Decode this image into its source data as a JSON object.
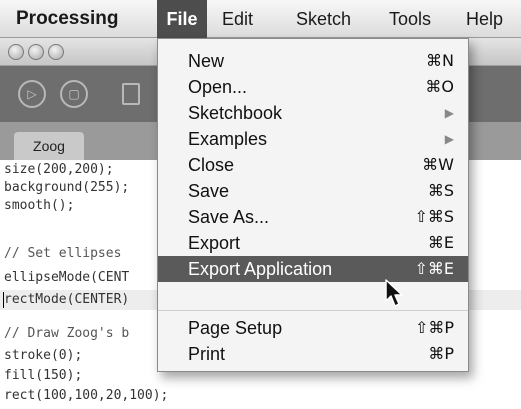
{
  "menubar": {
    "app_name": "Processing",
    "file": "File",
    "edit": "Edit",
    "sketch": "Sketch",
    "tools": "Tools",
    "help": "Help"
  },
  "editor": {
    "tab_label": "Zoog",
    "code_lines": [
      "size(200,200);",
      "background(255);",
      "smooth();",
      "",
      "// Set ellipses",
      "ellipseMode(CENT",
      "rectMode(CENTER)",
      "",
      "// Draw Zoog's b",
      "stroke(0);",
      "fill(150);",
      "rect(100,100,20,100);"
    ]
  },
  "file_menu": {
    "items": [
      {
        "label": "New",
        "shortcut": "⌘N"
      },
      {
        "label": "Open...",
        "shortcut": "⌘O"
      },
      {
        "label": "Sketchbook",
        "shortcut": "▶"
      },
      {
        "label": "Examples",
        "shortcut": "▶"
      },
      {
        "label": "Close",
        "shortcut": "⌘W"
      },
      {
        "label": "Save",
        "shortcut": "⌘S"
      },
      {
        "label": "Save As...",
        "shortcut": "⇧⌘S"
      },
      {
        "label": "Export",
        "shortcut": "⌘E"
      },
      {
        "label": "Export Application",
        "shortcut": "⇧⌘E"
      },
      {
        "label": "Page Setup",
        "shortcut": "⇧⌘P"
      },
      {
        "label": "Print",
        "shortcut": "⌘P"
      }
    ]
  },
  "colors": {
    "menu_highlight": "#5a5a5a",
    "toolbar_bg": "#6e6e6e",
    "tabstrip_bg": "#9a9a9a"
  }
}
